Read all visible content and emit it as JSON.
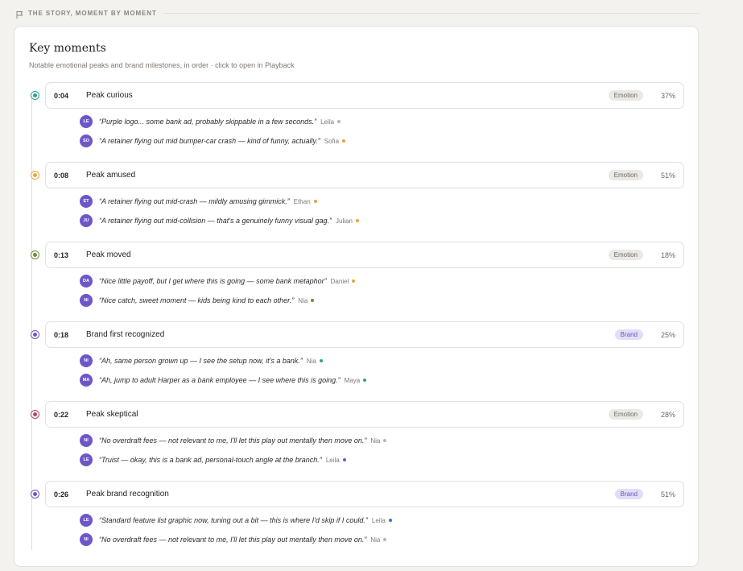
{
  "section": {
    "title": "THE STORY, MOMENT BY MOMENT",
    "icon": "flag-icon"
  },
  "card": {
    "title": "Key moments",
    "subtitle": "Notable emotional peaks and brand milestones, in order · click to open in Playback"
  },
  "moments": [
    {
      "time": "0:04",
      "label": "Peak curious",
      "tag": "Emotion",
      "pct": "37%",
      "color": "#2aa198",
      "quotes": [
        {
          "initials": "LE",
          "text": "“Purple logo... some bank ad, probably skippable in a few seconds.”",
          "author": "Leila",
          "dot": "#b9b4ae"
        },
        {
          "initials": "SO",
          "text": "“A retainer flying out mid bumper-car crash — kind of funny, actually.”",
          "author": "Sofia",
          "dot": "#e8a33d"
        }
      ]
    },
    {
      "time": "0:08",
      "label": "Peak amused",
      "tag": "Emotion",
      "pct": "51%",
      "color": "#e8a33d",
      "quotes": [
        {
          "initials": "ET",
          "text": "“A retainer flying out mid-crash — mildly amusing gimmick.”",
          "author": "Ethan",
          "dot": "#e8a33d"
        },
        {
          "initials": "JU",
          "text": "“A retainer flying out mid-collision — that's a genuinely funny visual gag.”",
          "author": "Julian",
          "dot": "#e8a33d"
        }
      ]
    },
    {
      "time": "0:13",
      "label": "Peak moved",
      "tag": "Emotion",
      "pct": "18%",
      "color": "#6a8f3c",
      "quotes": [
        {
          "initials": "DA",
          "text": "“Nice little payoff, but I get where this is going — some bank metaphor”",
          "author": "Daniel",
          "dot": "#e8a33d"
        },
        {
          "initials": "NI",
          "text": "“Nice catch, sweet moment — kids being kind to each other.”",
          "author": "Nia",
          "dot": "#6a8f3c"
        }
      ]
    },
    {
      "time": "0:18",
      "label": "Brand first recognized",
      "tag": "Brand",
      "pct": "25%",
      "color": "#6f56c8",
      "quotes": [
        {
          "initials": "NI",
          "text": "“Ah, same person grown up — I see the setup now, it's a bank.”",
          "author": "Nia",
          "dot": "#2aa198"
        },
        {
          "initials": "MA",
          "text": "“Ah, jump to adult Harper as a bank employee — I see where this is going.”",
          "author": "Maya",
          "dot": "#2aa198"
        }
      ]
    },
    {
      "time": "0:22",
      "label": "Peak skeptical",
      "tag": "Emotion",
      "pct": "28%",
      "color": "#b0476a",
      "quotes": [
        {
          "initials": "NI",
          "text": "“No overdraft fees — not relevant to me, I'll let this play out mentally then move on.”",
          "author": "Nia",
          "dot": "#b9b4ae"
        },
        {
          "initials": "LE",
          "text": "“Truist — okay, this is a bank ad, personal-touch angle at the branch.”",
          "author": "Leila",
          "dot": "#6f56c8"
        }
      ]
    },
    {
      "time": "0:26",
      "label": "Peak brand recognition",
      "tag": "Brand",
      "pct": "51%",
      "color": "#6f56c8",
      "quotes": [
        {
          "initials": "LE",
          "text": "“Standard feature list graphic now, tuning out a bit — this is where I'd skip if I could.”",
          "author": "Leila",
          "dot": "#3a6fd8"
        },
        {
          "initials": "NI",
          "text": "“No overdraft fees — not relevant to me, I'll let this play out mentally then move on.”",
          "author": "Nia",
          "dot": "#b9b4ae"
        }
      ]
    }
  ]
}
